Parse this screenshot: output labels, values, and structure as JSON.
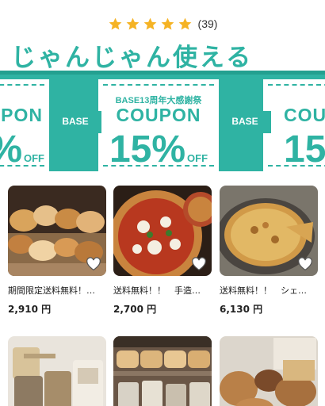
{
  "rating": {
    "stars": 5,
    "count_text": "(39)",
    "star_color": "#f5b324"
  },
  "banner": {
    "headline": "じゃんじゃん使える",
    "coupons": [
      {
        "subtitle": "",
        "label": "PON",
        "percent": "5%",
        "off": "OFF"
      },
      {
        "subtitle": "BASE13周年大感謝祭",
        "label": "COUPON",
        "percent": "15%",
        "off": "OFF"
      },
      {
        "subtitle": "",
        "label": "COU",
        "percent": "15",
        "off": ""
      }
    ],
    "badges": [
      "BASE",
      "BASE"
    ],
    "accent_color": "#2fb3a3"
  },
  "products": [
    {
      "title": "期間限定送料無料！…",
      "price": "2,910 円"
    },
    {
      "title": "送料無料！！　手造…",
      "price": "2,700 円"
    },
    {
      "title": "送料無料！！　シェ…",
      "price": "6,130 円"
    },
    {
      "title": "",
      "price": ""
    },
    {
      "title": "",
      "price": ""
    },
    {
      "title": "",
      "price": ""
    }
  ]
}
